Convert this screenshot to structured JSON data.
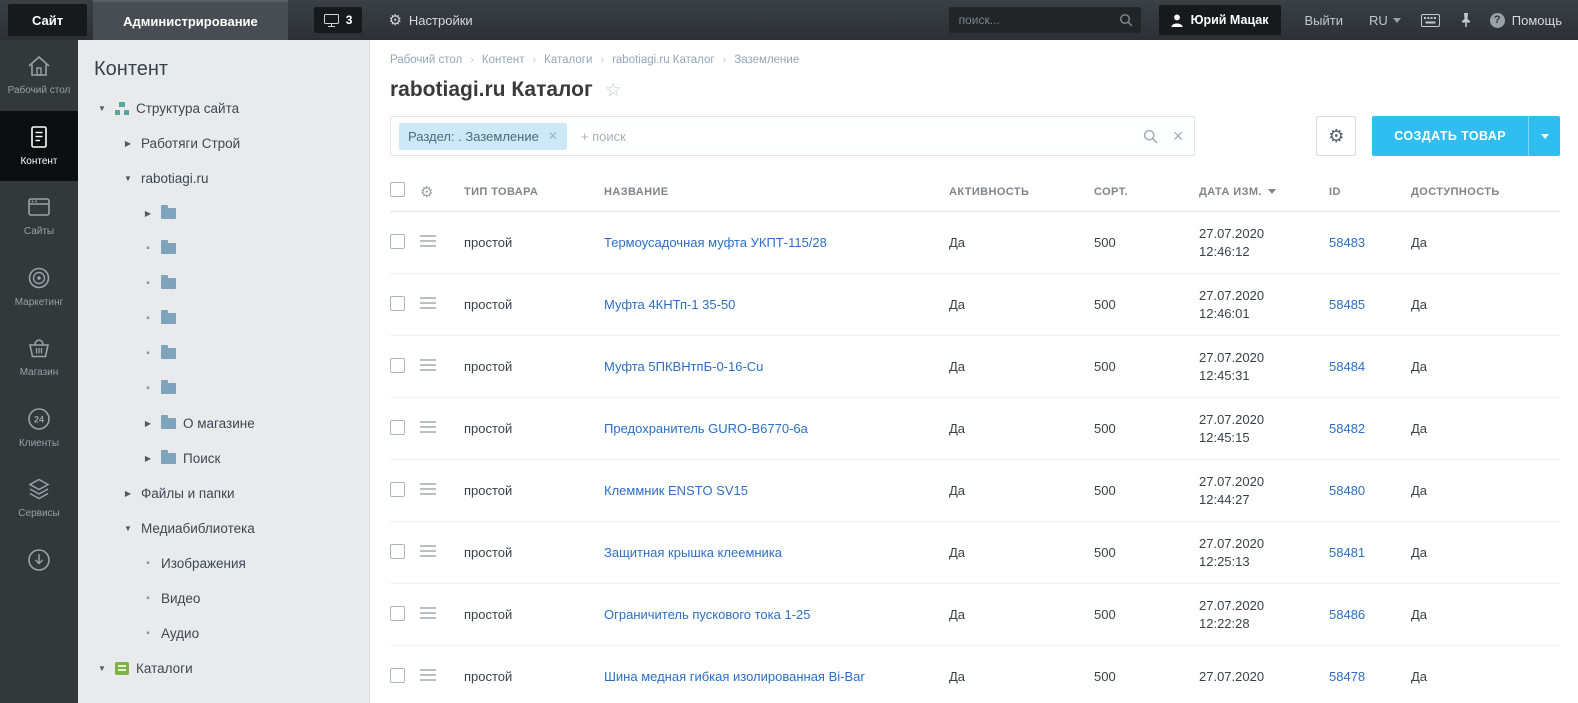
{
  "topbar": {
    "site_button": "Сайт",
    "admin_tab": "Администрирование",
    "notifications_count": "3",
    "settings_label": "Настройки",
    "search_placeholder": "поиск...",
    "user_name": "Юрий Мацак",
    "logout_label": "Выйти",
    "language": "RU",
    "help_label": "Помощь"
  },
  "rail": {
    "items": [
      {
        "label": "Рабочий стол",
        "icon": "home-icon"
      },
      {
        "label": "Контент",
        "icon": "document-icon",
        "active": true
      },
      {
        "label": "Сайты",
        "icon": "browser-icon"
      },
      {
        "label": "Маркетинг",
        "icon": "target-icon"
      },
      {
        "label": "Магазин",
        "icon": "basket-icon"
      },
      {
        "label": "Клиенты",
        "icon": "clients-24-icon"
      },
      {
        "label": "Сервисы",
        "icon": "layers-icon"
      }
    ]
  },
  "tree": {
    "heading": "Контент",
    "items": [
      {
        "depth": "0",
        "state": "open",
        "icon": "structure",
        "label": "Структура сайта"
      },
      {
        "depth": "1",
        "state": "closed",
        "icon": "none",
        "label": "Работяги Строй"
      },
      {
        "depth": "1",
        "state": "open",
        "icon": "none",
        "label": "rabotiagi.ru"
      },
      {
        "depth": "2",
        "state": "closed",
        "icon": "folder",
        "label": ""
      },
      {
        "depth": "2",
        "state": "leaf",
        "icon": "folder",
        "label": ""
      },
      {
        "depth": "2",
        "state": "leaf",
        "icon": "folder",
        "label": ""
      },
      {
        "depth": "2",
        "state": "leaf",
        "icon": "folder",
        "label": ""
      },
      {
        "depth": "2",
        "state": "leaf",
        "icon": "folder",
        "label": ""
      },
      {
        "depth": "2",
        "state": "leaf",
        "icon": "folder",
        "label": ""
      },
      {
        "depth": "2",
        "state": "closed",
        "icon": "folder",
        "label": "О магазине"
      },
      {
        "depth": "2",
        "state": "closed",
        "icon": "folder",
        "label": "Поиск"
      },
      {
        "depth": "1",
        "state": "closed",
        "icon": "none",
        "label": "Файлы и папки"
      },
      {
        "depth": "1",
        "state": "open",
        "icon": "none",
        "label": "Медиабиблиотека"
      },
      {
        "depth": "2",
        "state": "leaf",
        "icon": "none",
        "label": "Изображения"
      },
      {
        "depth": "2",
        "state": "leaf",
        "icon": "none",
        "label": "Видео"
      },
      {
        "depth": "2",
        "state": "leaf",
        "icon": "none",
        "label": "Аудио"
      },
      {
        "depth": "0",
        "state": "open",
        "icon": "catalog",
        "label": "Каталоги"
      }
    ]
  },
  "breadcrumb": [
    "Рабочий стол",
    "Контент",
    "Каталоги",
    "rabotiagi.ru Каталог",
    "Заземление"
  ],
  "page": {
    "title": "rabotiagi.ru Каталог"
  },
  "filter": {
    "chip": "Раздел: . Заземление",
    "placeholder": "+ поиск"
  },
  "toolbar": {
    "create_button": "СОЗДАТЬ ТОВАР"
  },
  "table": {
    "columns": [
      "ТИП ТОВАРА",
      "НАЗВАНИЕ",
      "АКТИВНОСТЬ",
      "СОРТ.",
      "ДАТА ИЗМ.",
      "ID",
      "ДОСТУПНОСТЬ"
    ],
    "rows": [
      {
        "type": "простой",
        "name": "Термоусадочная муфта УКПТ-115/28",
        "active": "Да",
        "sort": "500",
        "date": "27.07.2020",
        "time": "12:46:12",
        "id": "58483",
        "availability": "Да"
      },
      {
        "type": "простой",
        "name": "Муфта 4КНТп-1 35-50",
        "active": "Да",
        "sort": "500",
        "date": "27.07.2020",
        "time": "12:46:01",
        "id": "58485",
        "availability": "Да"
      },
      {
        "type": "простой",
        "name": "Муфта 5ПКВНтпБ-0-16-Cu",
        "active": "Да",
        "sort": "500",
        "date": "27.07.2020",
        "time": "12:45:31",
        "id": "58484",
        "availability": "Да"
      },
      {
        "type": "простой",
        "name": "Предохранитель GURO-B6770-6a",
        "active": "Да",
        "sort": "500",
        "date": "27.07.2020",
        "time": "12:45:15",
        "id": "58482",
        "availability": "Да"
      },
      {
        "type": "простой",
        "name": "Клеммник ENSTO SV15",
        "active": "Да",
        "sort": "500",
        "date": "27.07.2020",
        "time": "12:44:27",
        "id": "58480",
        "availability": "Да"
      },
      {
        "type": "простой",
        "name": "Защитная крышка клеемника",
        "active": "Да",
        "sort": "500",
        "date": "27.07.2020",
        "time": "12:25:13",
        "id": "58481",
        "availability": "Да"
      },
      {
        "type": "простой",
        "name": "Ограничитель пускового тока 1-25",
        "active": "Да",
        "sort": "500",
        "date": "27.07.2020",
        "time": "12:22:28",
        "id": "58486",
        "availability": "Да"
      },
      {
        "type": "простой",
        "name": "Шина медная гибкая изолированная Bi-Bar",
        "active": "Да",
        "sort": "500",
        "date": "27.07.2020",
        "time": "",
        "id": "58478",
        "availability": "Да"
      }
    ]
  },
  "colors": {
    "accent": "#30bef0",
    "link": "#2d6fc4",
    "chip_bg": "#cde9f8"
  }
}
